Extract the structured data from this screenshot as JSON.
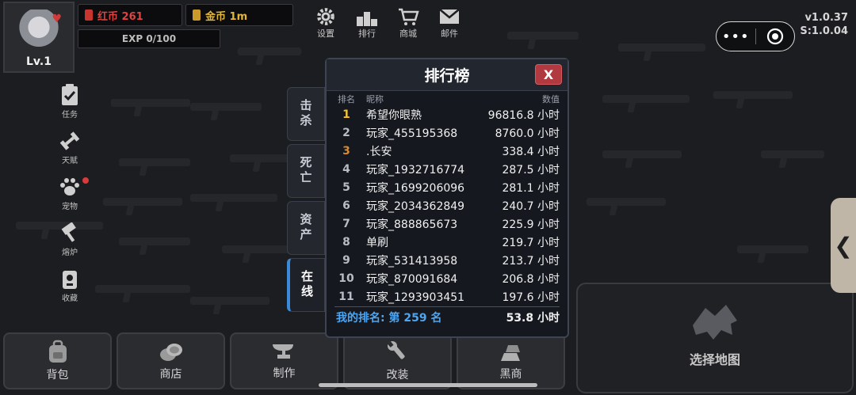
{
  "player": {
    "level": "Lv.1",
    "red_coin_label": "红币 261",
    "gold_coin_label": "金币 1m",
    "exp": "EXP 0/100"
  },
  "top_menu": [
    {
      "label": "设置",
      "icon": "gear-icon"
    },
    {
      "label": "排行",
      "icon": "podium-icon"
    },
    {
      "label": "商城",
      "icon": "cart-icon"
    },
    {
      "label": "邮件",
      "icon": "mail-icon"
    }
  ],
  "version": {
    "client": "v1.0.37",
    "server": "S:1.0.04"
  },
  "capsule": {
    "more": "•••"
  },
  "side_menu": [
    {
      "label": "任务",
      "icon": "clipboard-icon"
    },
    {
      "label": "天赋",
      "icon": "dumbbell-icon"
    },
    {
      "label": "宠物",
      "icon": "paw-icon"
    },
    {
      "label": "熔炉",
      "icon": "hammer-icon"
    },
    {
      "label": "收藏",
      "icon": "collection-icon"
    }
  ],
  "bottom_menu": [
    {
      "label": "背包",
      "icon": "backpack-icon"
    },
    {
      "label": "商店",
      "icon": "coins-icon"
    },
    {
      "label": "制作",
      "icon": "anvil-icon"
    },
    {
      "label": "改装",
      "icon": "wrench-icon"
    },
    {
      "label": "黑商",
      "icon": "gold-bars-icon"
    }
  ],
  "map_button": {
    "label": "选择地图"
  },
  "side_handle": {
    "glyph": "❮"
  },
  "leaderboard": {
    "title": "排行榜",
    "close_label": "X",
    "tabs": [
      {
        "label": "击杀",
        "active": false
      },
      {
        "label": "死亡",
        "active": false
      },
      {
        "label": "资产",
        "active": false
      },
      {
        "label": "在线",
        "active": true
      }
    ],
    "columns": {
      "rank": "排名",
      "name": "昵称",
      "value": "数值"
    },
    "rows": [
      {
        "rank": "1",
        "name": "希望你眼熟",
        "value": "96816.8 小时"
      },
      {
        "rank": "2",
        "name": "玩家_455195368",
        "value": "8760.0 小时"
      },
      {
        "rank": "3",
        "name": ".长安",
        "value": "338.4 小时"
      },
      {
        "rank": "4",
        "name": "玩家_1932716774",
        "value": "287.5 小时"
      },
      {
        "rank": "5",
        "name": "玩家_1699206096",
        "value": "281.1 小时"
      },
      {
        "rank": "6",
        "name": "玩家_2034362849",
        "value": "240.7 小时"
      },
      {
        "rank": "7",
        "name": "玩家_888865673",
        "value": "225.9 小时"
      },
      {
        "rank": "8",
        "name": "单刷",
        "value": "219.7 小时"
      },
      {
        "rank": "9",
        "name": "玩家_531413958",
        "value": "213.7 小时"
      },
      {
        "rank": "10",
        "name": "玩家_870091684",
        "value": "206.8 小时"
      },
      {
        "rank": "11",
        "name": "玩家_1293903451",
        "value": "197.6 小时"
      }
    ],
    "my_rank": {
      "label": "我的排名: 第 259 名",
      "value": "53.8 小时"
    }
  },
  "colors": {
    "background": "#1c1d20",
    "red_coin": "#e0433f",
    "gold_coin": "#e2b63a",
    "first_place": "#f2c230",
    "third_place": "#d88a2e",
    "my_rank": "#4ea6f2",
    "close_button": "#b03a3f"
  }
}
